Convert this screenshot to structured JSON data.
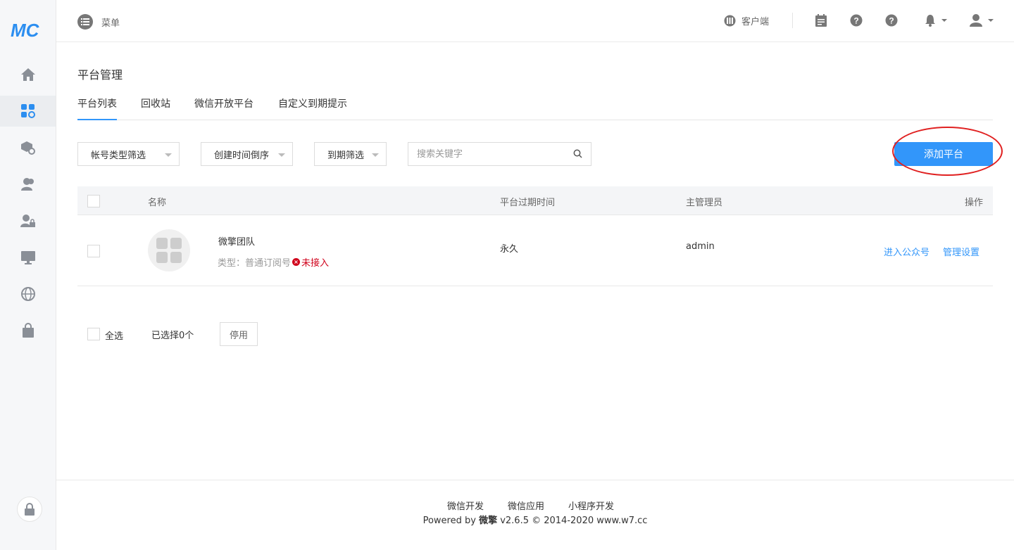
{
  "app": {
    "logo_text": "MC"
  },
  "topbar": {
    "menu_label": "菜单",
    "client_label": "客户端"
  },
  "page": {
    "title": "平台管理"
  },
  "tabs": [
    {
      "label": "平台列表",
      "active": true
    },
    {
      "label": "回收站",
      "active": false
    },
    {
      "label": "微信开放平台",
      "active": false
    },
    {
      "label": "自定义到期提示",
      "active": false
    }
  ],
  "filters": {
    "account_type": "帐号类型筛选",
    "create_time": "创建时间倒序",
    "expire": "到期筛选",
    "search_placeholder": "搜索关键字"
  },
  "add_button": "添加平台",
  "table": {
    "headers": {
      "name": "名称",
      "expire": "平台过期时间",
      "admin": "主管理员",
      "actions": "操作"
    },
    "rows": [
      {
        "name": "微擎团队",
        "type_label": "类型：普通订阅号",
        "status": "未接入",
        "expire": "永久",
        "admin": "admin",
        "actions": [
          "进入公众号",
          "管理设置"
        ]
      }
    ]
  },
  "bulk": {
    "select_all": "全选",
    "selected_count": "已选择0个",
    "disable_button": "停用"
  },
  "footer": {
    "links": [
      "微信开发",
      "微信应用",
      "小程序开发"
    ],
    "powered_prefix": "Powered by ",
    "brand": "微擎",
    "version_info": " v2.6.5 © 2014-2020 www.w7.cc"
  },
  "colors": {
    "accent": "#3296fa",
    "danger": "#d0021b",
    "sidebar_bg": "#f6f7f9"
  }
}
